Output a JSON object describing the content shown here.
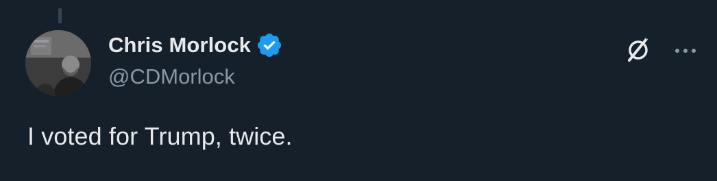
{
  "tweet": {
    "author": {
      "display_name": "Chris Morlock",
      "handle": "@CDMorlock",
      "verified": true
    },
    "text": "I voted for Trump, twice."
  },
  "icons": {
    "verified": "verified-badge-icon",
    "grok": "grok-icon",
    "more": "more-options-icon"
  },
  "colors": {
    "background": "#15202b",
    "text_primary": "#e7e9ea",
    "text_secondary": "#8b98a5",
    "verified_blue": "#1d9bf0"
  }
}
